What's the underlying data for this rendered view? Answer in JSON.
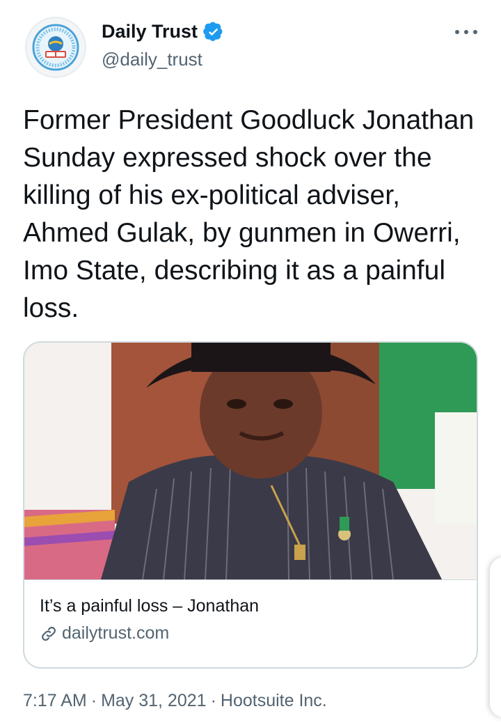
{
  "header": {
    "display_name": "Daily Trust",
    "handle": "@daily_trust",
    "avatar_icon": "daily-trust-logo-icon",
    "verified_icon": "verified-badge-icon",
    "more_icon": "more-options-icon"
  },
  "tweet": {
    "text": "Former President Goodluck Jonathan Sunday expressed shock over the killing of his ex-political adviser, Ahmed Gulak, by gunmen in Owerri, Imo State, describing it as a painful loss."
  },
  "card": {
    "title": "It’s a painful loss – Jonathan",
    "domain": "dailytrust.com",
    "link_icon": "link-icon"
  },
  "meta": {
    "time": "7:17 AM",
    "date": "May 31, 2021",
    "source": "Hootsuite Inc.",
    "separator": "·"
  },
  "colors": {
    "text": "#0f1419",
    "secondary": "#536471",
    "verified": "#1d9bf0",
    "border": "#cfd9de"
  }
}
